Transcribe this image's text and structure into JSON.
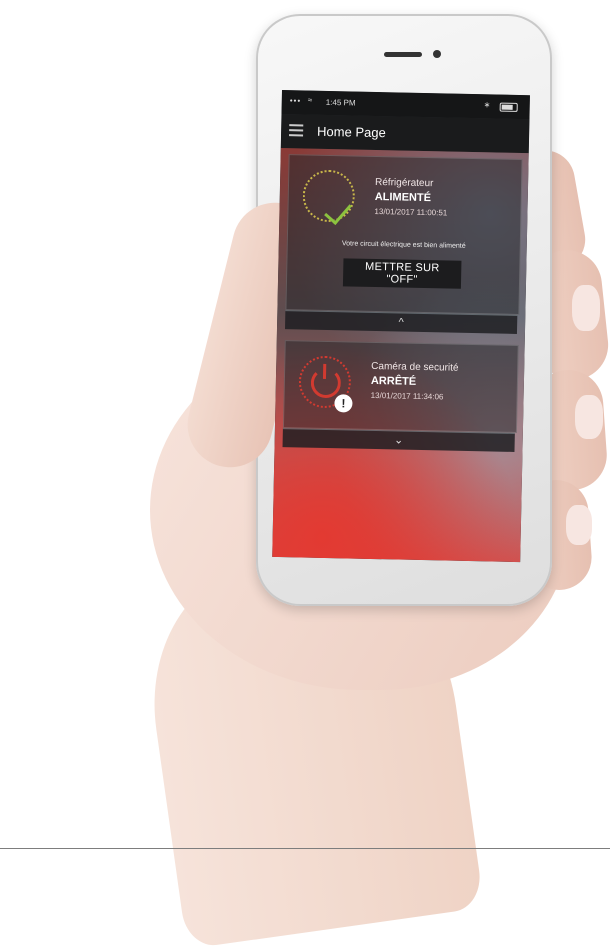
{
  "status_bar": {
    "signal": "•••",
    "wifi": "≈",
    "time": "1:45 PM",
    "bluetooth": "∗"
  },
  "app_bar": {
    "title": "Home Page"
  },
  "cards": [
    {
      "device": "Réfrigérateur",
      "state": "ALIMENTÉ",
      "timestamp": "13/01/2017 11:00:51",
      "message": "Votre circuit électrique est bien alimenté",
      "button": "METTRE SUR \"OFF\"",
      "toggle": "^",
      "status_color": "#8cc23f"
    },
    {
      "device": "Caméra de securité",
      "state": "ARRÊTÉ",
      "timestamp": "13/01/2017 11:34:06",
      "alert": "!",
      "toggle": "⌄",
      "status_color": "#d23a30"
    }
  ],
  "icons": {
    "menu": "hamburger-icon",
    "ok": "check-icon",
    "off": "power-icon",
    "alert": "alert-icon"
  }
}
